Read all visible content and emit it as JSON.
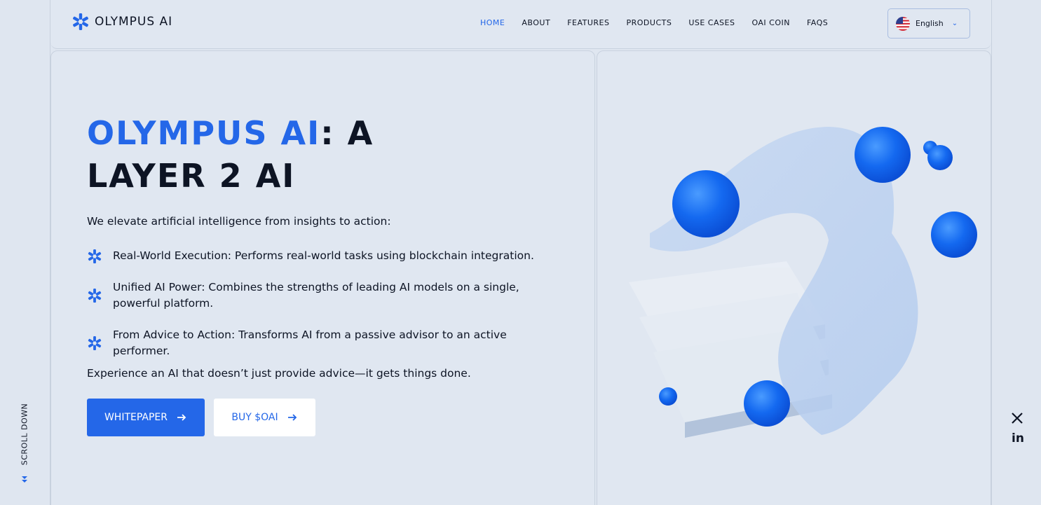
{
  "brand": {
    "name": "OLYMPUS AI",
    "accent_color": "#2467e8"
  },
  "nav": {
    "items": [
      {
        "label": "HOME",
        "active": true
      },
      {
        "label": "ABOUT",
        "active": false
      },
      {
        "label": "FEATURES",
        "active": false
      },
      {
        "label": "PRODUCTS",
        "active": false
      },
      {
        "label": "USE CASES",
        "active": false
      },
      {
        "label": "OAI COIN",
        "active": false
      },
      {
        "label": "FAQS",
        "active": false
      }
    ]
  },
  "language": {
    "selected": "English",
    "icon": "us-flag-icon"
  },
  "hero": {
    "title_accent": "OLYMPUS AI",
    "title_rest_1": ": A",
    "title_rest_2": "LAYER 2 AI",
    "intro": "We elevate artificial intelligence from insights to action:",
    "features": [
      "Real-World Execution: Performs real-world tasks using blockchain integration.",
      "Unified AI Power: Combines the strengths of leading AI models on a single, powerful platform.",
      "From Advice to Action: Transforms AI from a passive advisor to an active performer."
    ],
    "closing": "Experience an AI that doesn’t just provide advice—it gets things done."
  },
  "buttons": {
    "whitepaper": "WHITEPAPER",
    "buy": "BUY $OAI"
  },
  "scroll_hint": "SCROLL DOWN",
  "social": {
    "x_icon": "x-icon",
    "linkedin_label": "in"
  }
}
